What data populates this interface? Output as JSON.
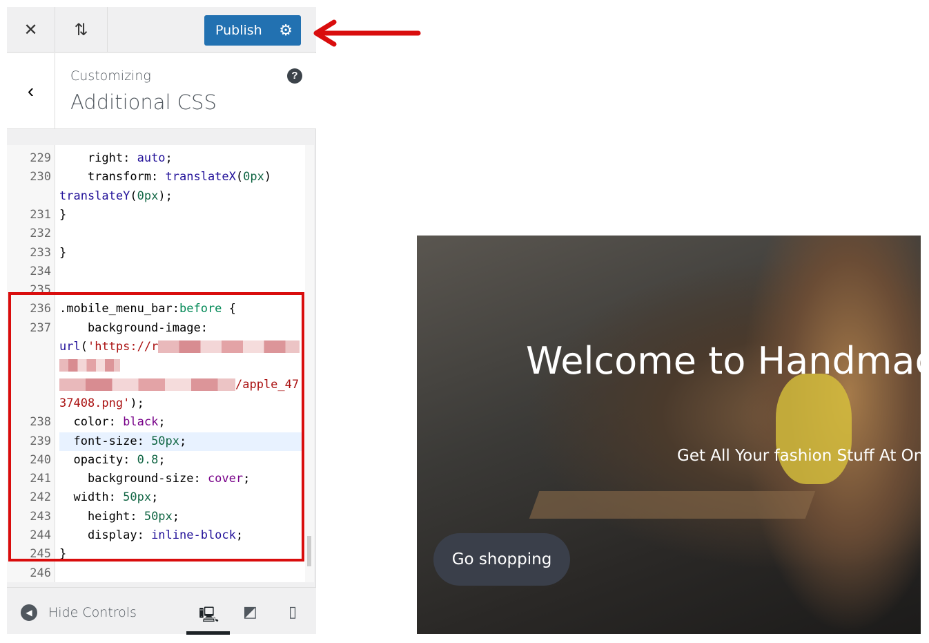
{
  "topbar": {
    "close_icon": "close-icon",
    "reorder_icon": "arrows-up-down-icon",
    "publish_label": "Publish",
    "settings_icon": "gear-icon"
  },
  "header": {
    "subtitle": "Customizing",
    "title": "Additional CSS",
    "back_icon": "chevron-left-icon",
    "help_icon": "question-icon"
  },
  "editor": {
    "highlighted_line": "239",
    "lines": [
      {
        "n": "229",
        "t": [
          [
            "t-sel",
            "    right: "
          ],
          [
            "t-val",
            "auto"
          ],
          [
            "t-sel",
            ";"
          ]
        ]
      },
      {
        "n": "230",
        "t": [
          [
            "t-sel",
            "    transform: "
          ],
          [
            "t-val",
            "translateX"
          ],
          [
            "t-sel",
            "("
          ],
          [
            "t-num",
            "0px"
          ],
          [
            "t-sel",
            ")"
          ]
        ]
      },
      {
        "n": "",
        "t": [
          [
            "t-val",
            "translateY"
          ],
          [
            "t-sel",
            "("
          ],
          [
            "t-num",
            "0px"
          ],
          [
            "t-sel",
            ");"
          ]
        ]
      },
      {
        "n": "231",
        "t": [
          [
            "t-sel",
            "}"
          ]
        ]
      },
      {
        "n": "232",
        "t": []
      },
      {
        "n": "233",
        "t": [
          [
            "t-sel",
            "}"
          ]
        ]
      },
      {
        "n": "234",
        "t": []
      },
      {
        "n": "235",
        "t": []
      },
      {
        "n": "236",
        "t": [
          [
            "t-sel",
            ".mobile_menu_bar:"
          ],
          [
            "t-kw",
            "before"
          ],
          [
            "t-sel",
            " {"
          ]
        ]
      },
      {
        "n": "237",
        "t": [
          [
            "t-sel",
            "    background-image:"
          ]
        ]
      },
      {
        "n": "",
        "t": [
          [
            "t-val",
            "url"
          ],
          [
            "t-sel",
            "("
          ],
          [
            "t-str",
            "'https://r"
          ],
          [
            "blur",
            ""
          ]
        ]
      },
      {
        "n": "",
        "t": [
          [
            "blur",
            ""
          ]
        ]
      },
      {
        "n": "",
        "t": [
          [
            "blur",
            ""
          ],
          [
            "t-str",
            "/apple_47"
          ]
        ]
      },
      {
        "n": "",
        "t": [
          [
            "t-str",
            "37408.png'"
          ],
          [
            "t-sel",
            ");"
          ]
        ]
      },
      {
        "n": "238",
        "t": [
          [
            "t-sel",
            "  color: "
          ],
          [
            "t-atom",
            "black"
          ],
          [
            "t-sel",
            ";"
          ]
        ]
      },
      {
        "n": "239",
        "t": [
          [
            "t-sel",
            "  font-size: "
          ],
          [
            "t-num",
            "50px"
          ],
          [
            "t-sel",
            ";"
          ]
        ]
      },
      {
        "n": "240",
        "t": [
          [
            "t-sel",
            "  opacity: "
          ],
          [
            "t-num",
            "0.8"
          ],
          [
            "t-sel",
            ";"
          ]
        ]
      },
      {
        "n": "241",
        "t": [
          [
            "t-sel",
            "    background-size: "
          ],
          [
            "t-atom",
            "cover"
          ],
          [
            "t-sel",
            ";"
          ]
        ]
      },
      {
        "n": "242",
        "t": [
          [
            "t-sel",
            "  width: "
          ],
          [
            "t-num",
            "50px"
          ],
          [
            "t-sel",
            ";"
          ]
        ]
      },
      {
        "n": "243",
        "t": [
          [
            "t-sel",
            "    height: "
          ],
          [
            "t-num",
            "50px"
          ],
          [
            "t-sel",
            ";"
          ]
        ]
      },
      {
        "n": "244",
        "t": [
          [
            "t-sel",
            "    display: "
          ],
          [
            "t-val",
            "inline-block"
          ],
          [
            "t-sel",
            ";"
          ]
        ]
      },
      {
        "n": "245",
        "t": [
          [
            "t-sel",
            "}"
          ]
        ]
      },
      {
        "n": "246",
        "t": []
      }
    ]
  },
  "footer": {
    "hide_controls": "Hide Controls",
    "devices": [
      "desktop-icon",
      "tablet-icon",
      "mobile-icon"
    ],
    "active_device": "desktop"
  },
  "preview": {
    "hero_title": "Welcome to Handmad",
    "hero_subtitle": "Get All Your fashion Stuff At One",
    "hero_button": "Go shopping"
  },
  "colors": {
    "accent": "#2271b1",
    "annotation": "#d90d0d"
  }
}
